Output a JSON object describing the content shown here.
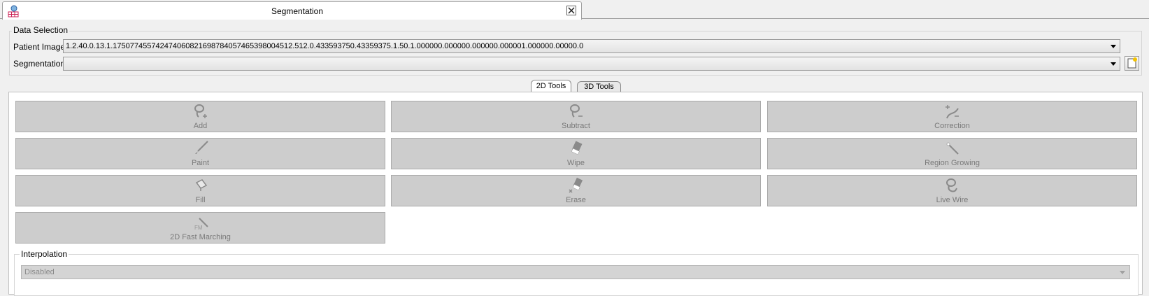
{
  "window": {
    "title": "Segmentation"
  },
  "data_selection": {
    "legend": "Data Selection",
    "patient_image_label": "Patient Image",
    "patient_image_value": "1.2.40.0.13.1.175077455742474060821698784057465398004512.512.0.433593750.43359375.1.50.1.000000.000000.000000.000001.000000.00000.0",
    "segmentation_label": "Segmentation",
    "segmentation_value": ""
  },
  "tool_tabs": [
    "2D Tools",
    "3D Tools"
  ],
  "tools": [
    {
      "label": "Add",
      "icon": "lasso-add-icon"
    },
    {
      "label": "Subtract",
      "icon": "lasso-subtract-icon"
    },
    {
      "label": "Correction",
      "icon": "correction-icon"
    },
    {
      "label": "Paint",
      "icon": "paint-brush-icon"
    },
    {
      "label": "Wipe",
      "icon": "eraser-icon"
    },
    {
      "label": "Region Growing",
      "icon": "magic-wand-icon"
    },
    {
      "label": "Fill",
      "icon": "fill-bucket-icon"
    },
    {
      "label": "Erase",
      "icon": "erase-icon"
    },
    {
      "label": "Live Wire",
      "icon": "live-wire-icon"
    },
    {
      "label": "2D Fast Marching",
      "icon": "fast-marching-icon"
    }
  ],
  "interpolation": {
    "legend": "Interpolation",
    "value": "Disabled"
  },
  "colors": {
    "button_bg": "#cdcdcd",
    "disabled_text": "#7a7a7a"
  }
}
